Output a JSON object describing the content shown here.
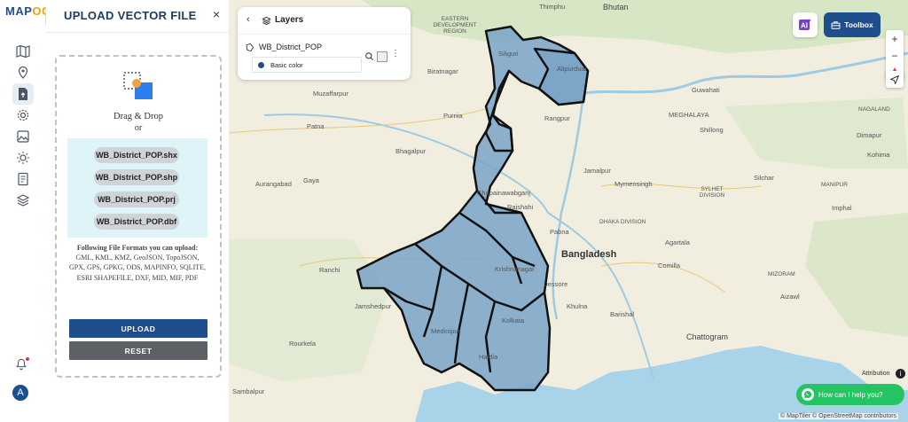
{
  "app": {
    "logo_prefix": "MAP",
    "logo_suffix": "OG"
  },
  "sidebar": {
    "icons": [
      "map-icon",
      "location-pin-icon",
      "upload-file-icon",
      "settings-icon",
      "image-icon",
      "sun-icon",
      "report-icon",
      "layers-icon"
    ],
    "notifications_icon": "bell-icon",
    "avatar_letter": "A"
  },
  "panel": {
    "title": "UPLOAD VECTOR FILE",
    "close_label": "×",
    "drag_drop": "Drag & Drop",
    "or": "or",
    "files": [
      "WB_District_POP.shx",
      "WB_District_POP.shp",
      "WB_District_POP.prj",
      "WB_District_POP.dbf"
    ],
    "formats_heading": "Following File Formats you can upload:",
    "formats_list": "GML, KML, KMZ, GeoJSON, TopoJSON, GPX, GPS, GPKG, ODS, MAPINFO, SQLITE, ESRI SHAPEFILE, DXF, MID, MIF, PDF",
    "upload_button": "UPLOAD",
    "reset_button": "RESET"
  },
  "layers_panel": {
    "title": "Layers",
    "layer_name": "WB_District_POP",
    "style_label": "Basic color",
    "style_color": "#1f4e8c"
  },
  "toolbar": {
    "toolbox_label": "Toolbox"
  },
  "map": {
    "place_labels": {
      "thimphu": "Thimphu",
      "bhutan": "Bhutan",
      "eastern_dev": "EASTERN DEVELOPMENT REGION",
      "siliguri": "Siliguri",
      "alipurduar": "Alipurduar",
      "biratnagar": "Biratnagar",
      "guwahati": "Guwahati",
      "muzaffarpur": "Muzaffarpur",
      "patna": "Patna",
      "purnia": "Purnia",
      "rangpur": "Rangpur",
      "meghalaya": "MEGHALAYA",
      "shillong": "Shillong",
      "bhagalpur": "Bhagalpur",
      "jamalpur": "Jamalpur",
      "mymensingh": "Mymensingh",
      "sylhet": "SYLHET DIVISION",
      "silchar": "Silchar",
      "aurangabad": "Aurangabad",
      "gaya": "Gaya",
      "nawabganj": "Chapainawabganj",
      "rajshahi": "Rajshahi",
      "dhaka_div": "DHAKA DIVISION",
      "pabna": "Pabna",
      "agartala": "Agartala",
      "bangladesh": "Bangladesh",
      "ranchi": "Ranchi",
      "krishnanagar": "Krishnanagar",
      "jessore": "Jessore",
      "comilla": "Comilla",
      "jamshedpur": "Jamshedpur",
      "khulna": "Khulna",
      "barishal": "Barishal",
      "kolkata": "Kolkata",
      "medinipur": "Medinipur",
      "rourkela": "Rourkela",
      "chattogram": "Chattogram",
      "haldia": "Haldia",
      "sambalpur": "Sambalpur",
      "aizawl": "Aizawl",
      "dimapur": "Dimapur",
      "imphal": "Imphal",
      "kohima": "Kohima",
      "nagaland": "NAGALAND",
      "manipur": "MANIPUR",
      "mizoram": "MIZORAM"
    },
    "attribution_label": "Attribution",
    "credits": "© MapTiler © OpenStreetMap contributors",
    "zoom_in": "+",
    "zoom_out": "−"
  },
  "chat": {
    "label": "How can I help you?"
  }
}
